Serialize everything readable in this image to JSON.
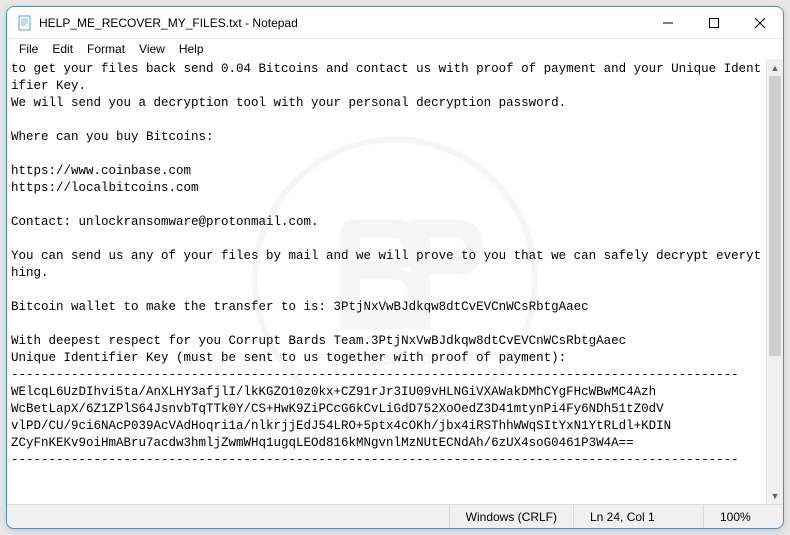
{
  "window": {
    "title": "HELP_ME_RECOVER_MY_FILES.txt - Notepad"
  },
  "menu": {
    "file": "File",
    "edit": "Edit",
    "format": "Format",
    "view": "View",
    "help": "Help"
  },
  "content": {
    "body": "to get your files back send 0.04 Bitcoins and contact us with proof of payment and your Unique Identifier Key.\nWe will send you a decryption tool with your personal decryption password.\n\nWhere can you buy Bitcoins:\n\nhttps://www.coinbase.com\nhttps://localbitcoins.com\n\nContact: unlockransomware@protonmail.com.\n\nYou can send us any of your files by mail and we will prove to you that we can safely decrypt everything.\n\nBitcoin wallet to make the transfer to is: 3PtjNxVwBJdkqw8dtCvEVCnWCsRbtgAaec\n\nWith deepest respect for you Corrupt Bards Team.3PtjNxVwBJdkqw8dtCvEVCnWCsRbtgAaec\nUnique Identifier Key (must be sent to us together with proof of payment):\n-------------------------------------------------------------------------------------------------\nWElcqL6UzDIhvi5ta/AnXLHY3afjlI/lkKGZO10z0kx+CZ91rJr3IU09vHLNGiVXAWakDMhCYgFHcWBwMC4Azh\nWcBetLapX/6Z1ZPlS64JsnvbTqTTk0Y/CS+HwK9ZiPCcG6kCvLiGdD752XoOedZ3D41mtynPi4Fy6NDh51tZ0dV\nvlPD/CU/9ci6NAcP039AcVAdHoqri1a/nlkrjjEdJ54LRO+5ptx4cOKh/jbx4iRSThhWWqSItYxN1YtRLdl+KDIN\nZCyFnKEKv9oiHmABru7acdw3hmljZwmWHq1ugqLEOd816kMNgvnlMzNUtECNdAh/6zUX4soG0461P3W4A==\n-------------------------------------------------------------------------------------------------"
  },
  "status": {
    "encoding": "Windows (CRLF)",
    "position": "Ln 24, Col 1",
    "zoom": "100%"
  }
}
